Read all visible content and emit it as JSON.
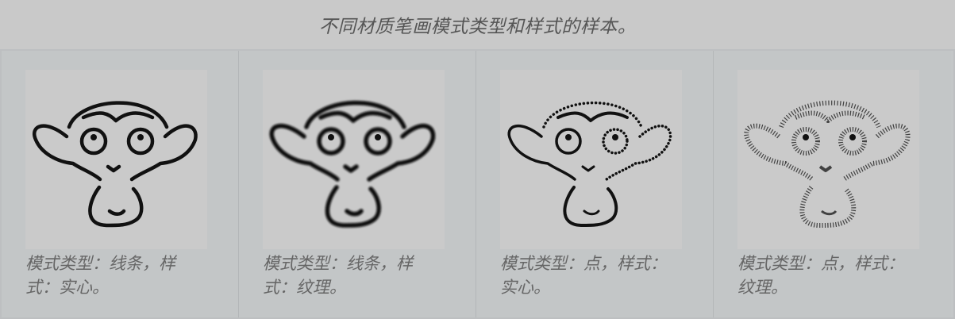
{
  "caption": "不同材质笔画模式类型和样式的样本。",
  "samples": [
    {
      "label_line1": "模式类型：线条，样",
      "label_line2": "式：实心。",
      "style": "line-solid",
      "icon": "monkey-head-icon"
    },
    {
      "label_line1": "模式类型：线条，样",
      "label_line2": "式：纹理。",
      "style": "line-texture",
      "icon": "monkey-head-icon"
    },
    {
      "label_line1": "模式类型：点，样式：",
      "label_line2": "实心。",
      "style": "dot-solid",
      "icon": "monkey-head-icon"
    },
    {
      "label_line1": "模式类型：点，样式：",
      "label_line2": "纹理。",
      "style": "dot-texture",
      "icon": "monkey-head-icon"
    }
  ]
}
